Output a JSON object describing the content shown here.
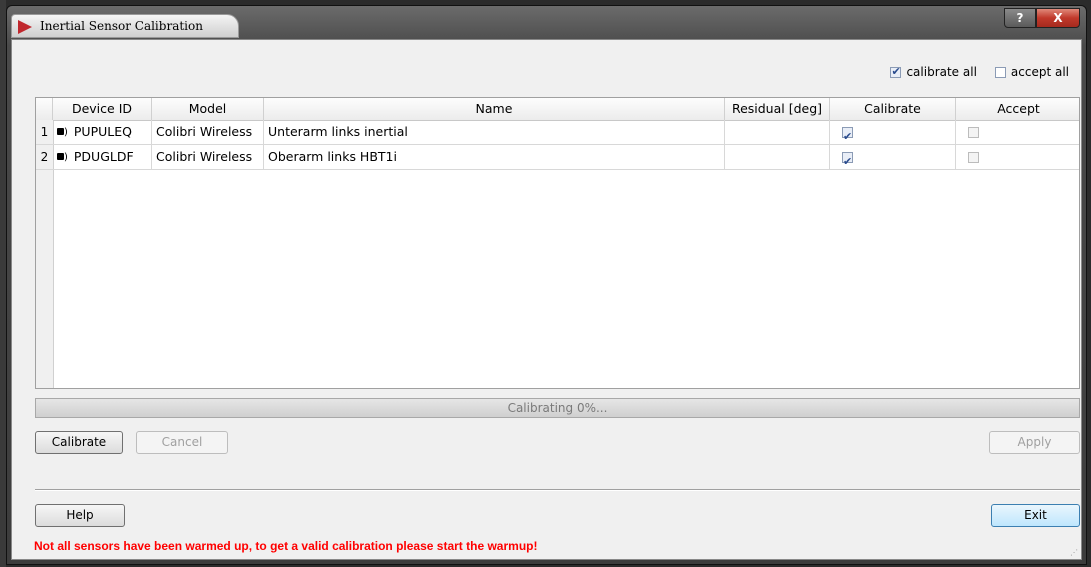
{
  "window": {
    "title": "Inertial Sensor Calibration",
    "help_glyph": "?",
    "close_glyph": "X"
  },
  "options": {
    "calibrate_all_label": "calibrate all",
    "calibrate_all_checked": true,
    "accept_all_label": "accept all",
    "accept_all_checked": false
  },
  "table": {
    "columns": [
      "Device ID",
      "Model",
      "Name",
      "Residual [deg]",
      "Calibrate",
      "Accept"
    ],
    "rows": [
      {
        "num": "1",
        "device_id": "PUPULEQ",
        "model": "Colibri Wireless",
        "name": "Unterarm links inertial",
        "residual": "",
        "calibrate": true,
        "accept": false
      },
      {
        "num": "2",
        "device_id": "PDUGLDF",
        "model": "Colibri Wireless",
        "name": "Oberarm links HBT1i",
        "residual": "",
        "calibrate": true,
        "accept": false
      }
    ]
  },
  "progress": {
    "text": "Calibrating 0%...",
    "value": 0
  },
  "buttons": {
    "calibrate": "Calibrate",
    "cancel": "Cancel",
    "apply": "Apply",
    "help": "Help",
    "exit": "Exit"
  },
  "status": {
    "warning": "Not all sensors have been warmed up, to get a valid calibration please start the warmup!",
    "warning_color": "#ff0000"
  },
  "icons": {
    "app": "app-logo-icon",
    "sensor": "wireless-sensor-icon"
  }
}
